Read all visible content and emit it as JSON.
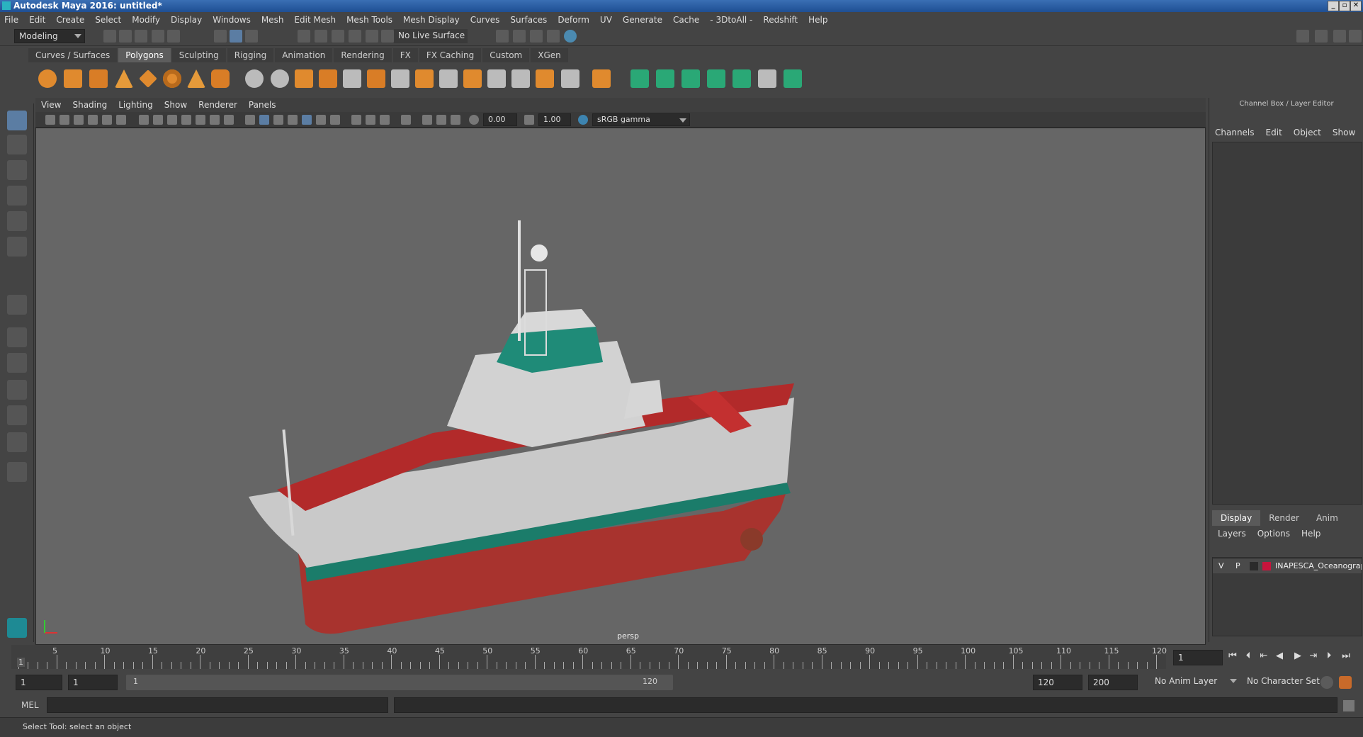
{
  "window": {
    "title": "Autodesk Maya 2016: untitled*"
  },
  "menubar": [
    "File",
    "Edit",
    "Create",
    "Select",
    "Modify",
    "Display",
    "Windows",
    "Mesh",
    "Edit Mesh",
    "Mesh Tools",
    "Mesh Display",
    "Curves",
    "Surfaces",
    "Deform",
    "UV",
    "Generate",
    "Cache",
    "- 3DtoAll -",
    "Redshift",
    "Help"
  ],
  "statusline": {
    "mode": "Modeling",
    "live_surface": "No Live Surface"
  },
  "shelf": {
    "tabs": [
      "Curves / Surfaces",
      "Polygons",
      "Sculpting",
      "Rigging",
      "Animation",
      "Rendering",
      "FX",
      "FX Caching",
      "Custom",
      "XGen"
    ],
    "active": "Polygons"
  },
  "viewport": {
    "menu": [
      "View",
      "Shading",
      "Lighting",
      "Show",
      "Renderer",
      "Panels"
    ],
    "exposure": "0.00",
    "gamma": "1.00",
    "colorspace": "sRGB gamma",
    "camera": "persp"
  },
  "channelbox": {
    "title": "Channel Box / Layer Editor",
    "menu": [
      "Channels",
      "Edit",
      "Object",
      "Show"
    ],
    "layer_tabs": [
      "Display",
      "Render",
      "Anim"
    ],
    "layer_menu": [
      "Layers",
      "Options",
      "Help"
    ],
    "layers": [
      {
        "v": "V",
        "p": "P",
        "name": "INAPESCA_Oceanograp",
        "color": "#c8143c"
      }
    ]
  },
  "timeline": {
    "ticks": [
      "5",
      "10",
      "15",
      "20",
      "25",
      "30",
      "35",
      "40",
      "45",
      "50",
      "55",
      "60",
      "65",
      "70",
      "75",
      "80",
      "85",
      "90",
      "95",
      "100",
      "105",
      "110",
      "115",
      "120"
    ],
    "current_marker": "1",
    "current_frame": "1"
  },
  "range": {
    "start": "1",
    "playback_start": "1",
    "slider_start": "1",
    "slider_end": "120",
    "playback_end": "120",
    "end": "200",
    "anim_layer": "No Anim Layer",
    "char_set": "No Character Set"
  },
  "cmdline": {
    "label": "MEL"
  },
  "helpline": {
    "text": "Select Tool: select an object"
  },
  "colors": {
    "accent": "#5b7da3",
    "bg": "#444444",
    "viewport": "#666666"
  }
}
